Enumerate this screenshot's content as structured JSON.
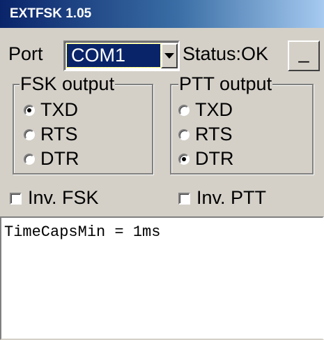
{
  "window": {
    "title": "EXTFSK 1.05"
  },
  "port": {
    "label": "Port",
    "selected": "COM1"
  },
  "status": {
    "text": "Status:OK"
  },
  "minimize_button": {
    "label": "_"
  },
  "fsk_output": {
    "title": "FSK output",
    "options": [
      {
        "label": "TXD",
        "selected": true
      },
      {
        "label": "RTS",
        "selected": false
      },
      {
        "label": "DTR",
        "selected": false
      }
    ]
  },
  "ptt_output": {
    "title": "PTT output",
    "options": [
      {
        "label": "TXD",
        "selected": false
      },
      {
        "label": "RTS",
        "selected": false
      },
      {
        "label": "DTR",
        "selected": true
      }
    ]
  },
  "checkboxes": {
    "inv_fsk": {
      "label": "Inv. FSK",
      "checked": false
    },
    "inv_ptt": {
      "label": "Inv. PTT",
      "checked": false
    }
  },
  "log": {
    "text": "TimeCapsMin = 1ms"
  }
}
